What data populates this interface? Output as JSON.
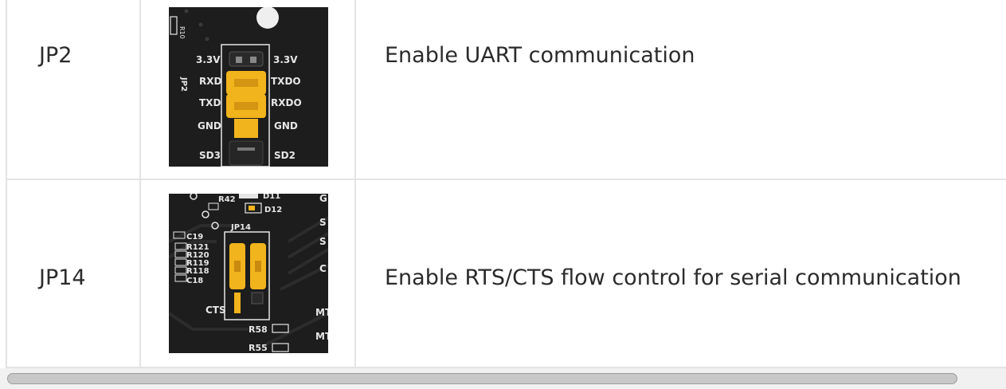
{
  "table": {
    "rows": [
      {
        "name": "JP2",
        "description": "Enable UART communication",
        "image": {
          "labels": {
            "r10": "R10",
            "jp": "JP2",
            "left_pins": [
              "3.3V",
              "RXD",
              "TXD",
              "GND",
              "SD3"
            ],
            "right_pins": [
              "3.3V",
              "TXDO",
              "RXDO",
              "GND",
              "SD2"
            ]
          }
        }
      },
      {
        "name": "JP14",
        "description": "Enable RTS/CTS flow control for serial communication",
        "image": {
          "labels": {
            "r42": "R42",
            "d11": "D11",
            "d12": "D12",
            "c19": "C19",
            "jp": "JP14",
            "resistors": [
              "R121",
              "R120",
              "R119",
              "R118"
            ],
            "c18": "C18",
            "cts": "CTS",
            "r58": "R58",
            "r55": "R55",
            "edge_right": [
              "G",
              "S",
              "S",
              "C",
              "MT",
              "MT"
            ]
          }
        }
      }
    ]
  },
  "colors": {
    "pcb": "#1d1d1d",
    "silkscreen": "#e6e6e6",
    "jumper": "#f2b41c",
    "border": "#e3e3e3",
    "text": "#2b2b2b",
    "scroll_thumb": "#c8c8c8"
  }
}
